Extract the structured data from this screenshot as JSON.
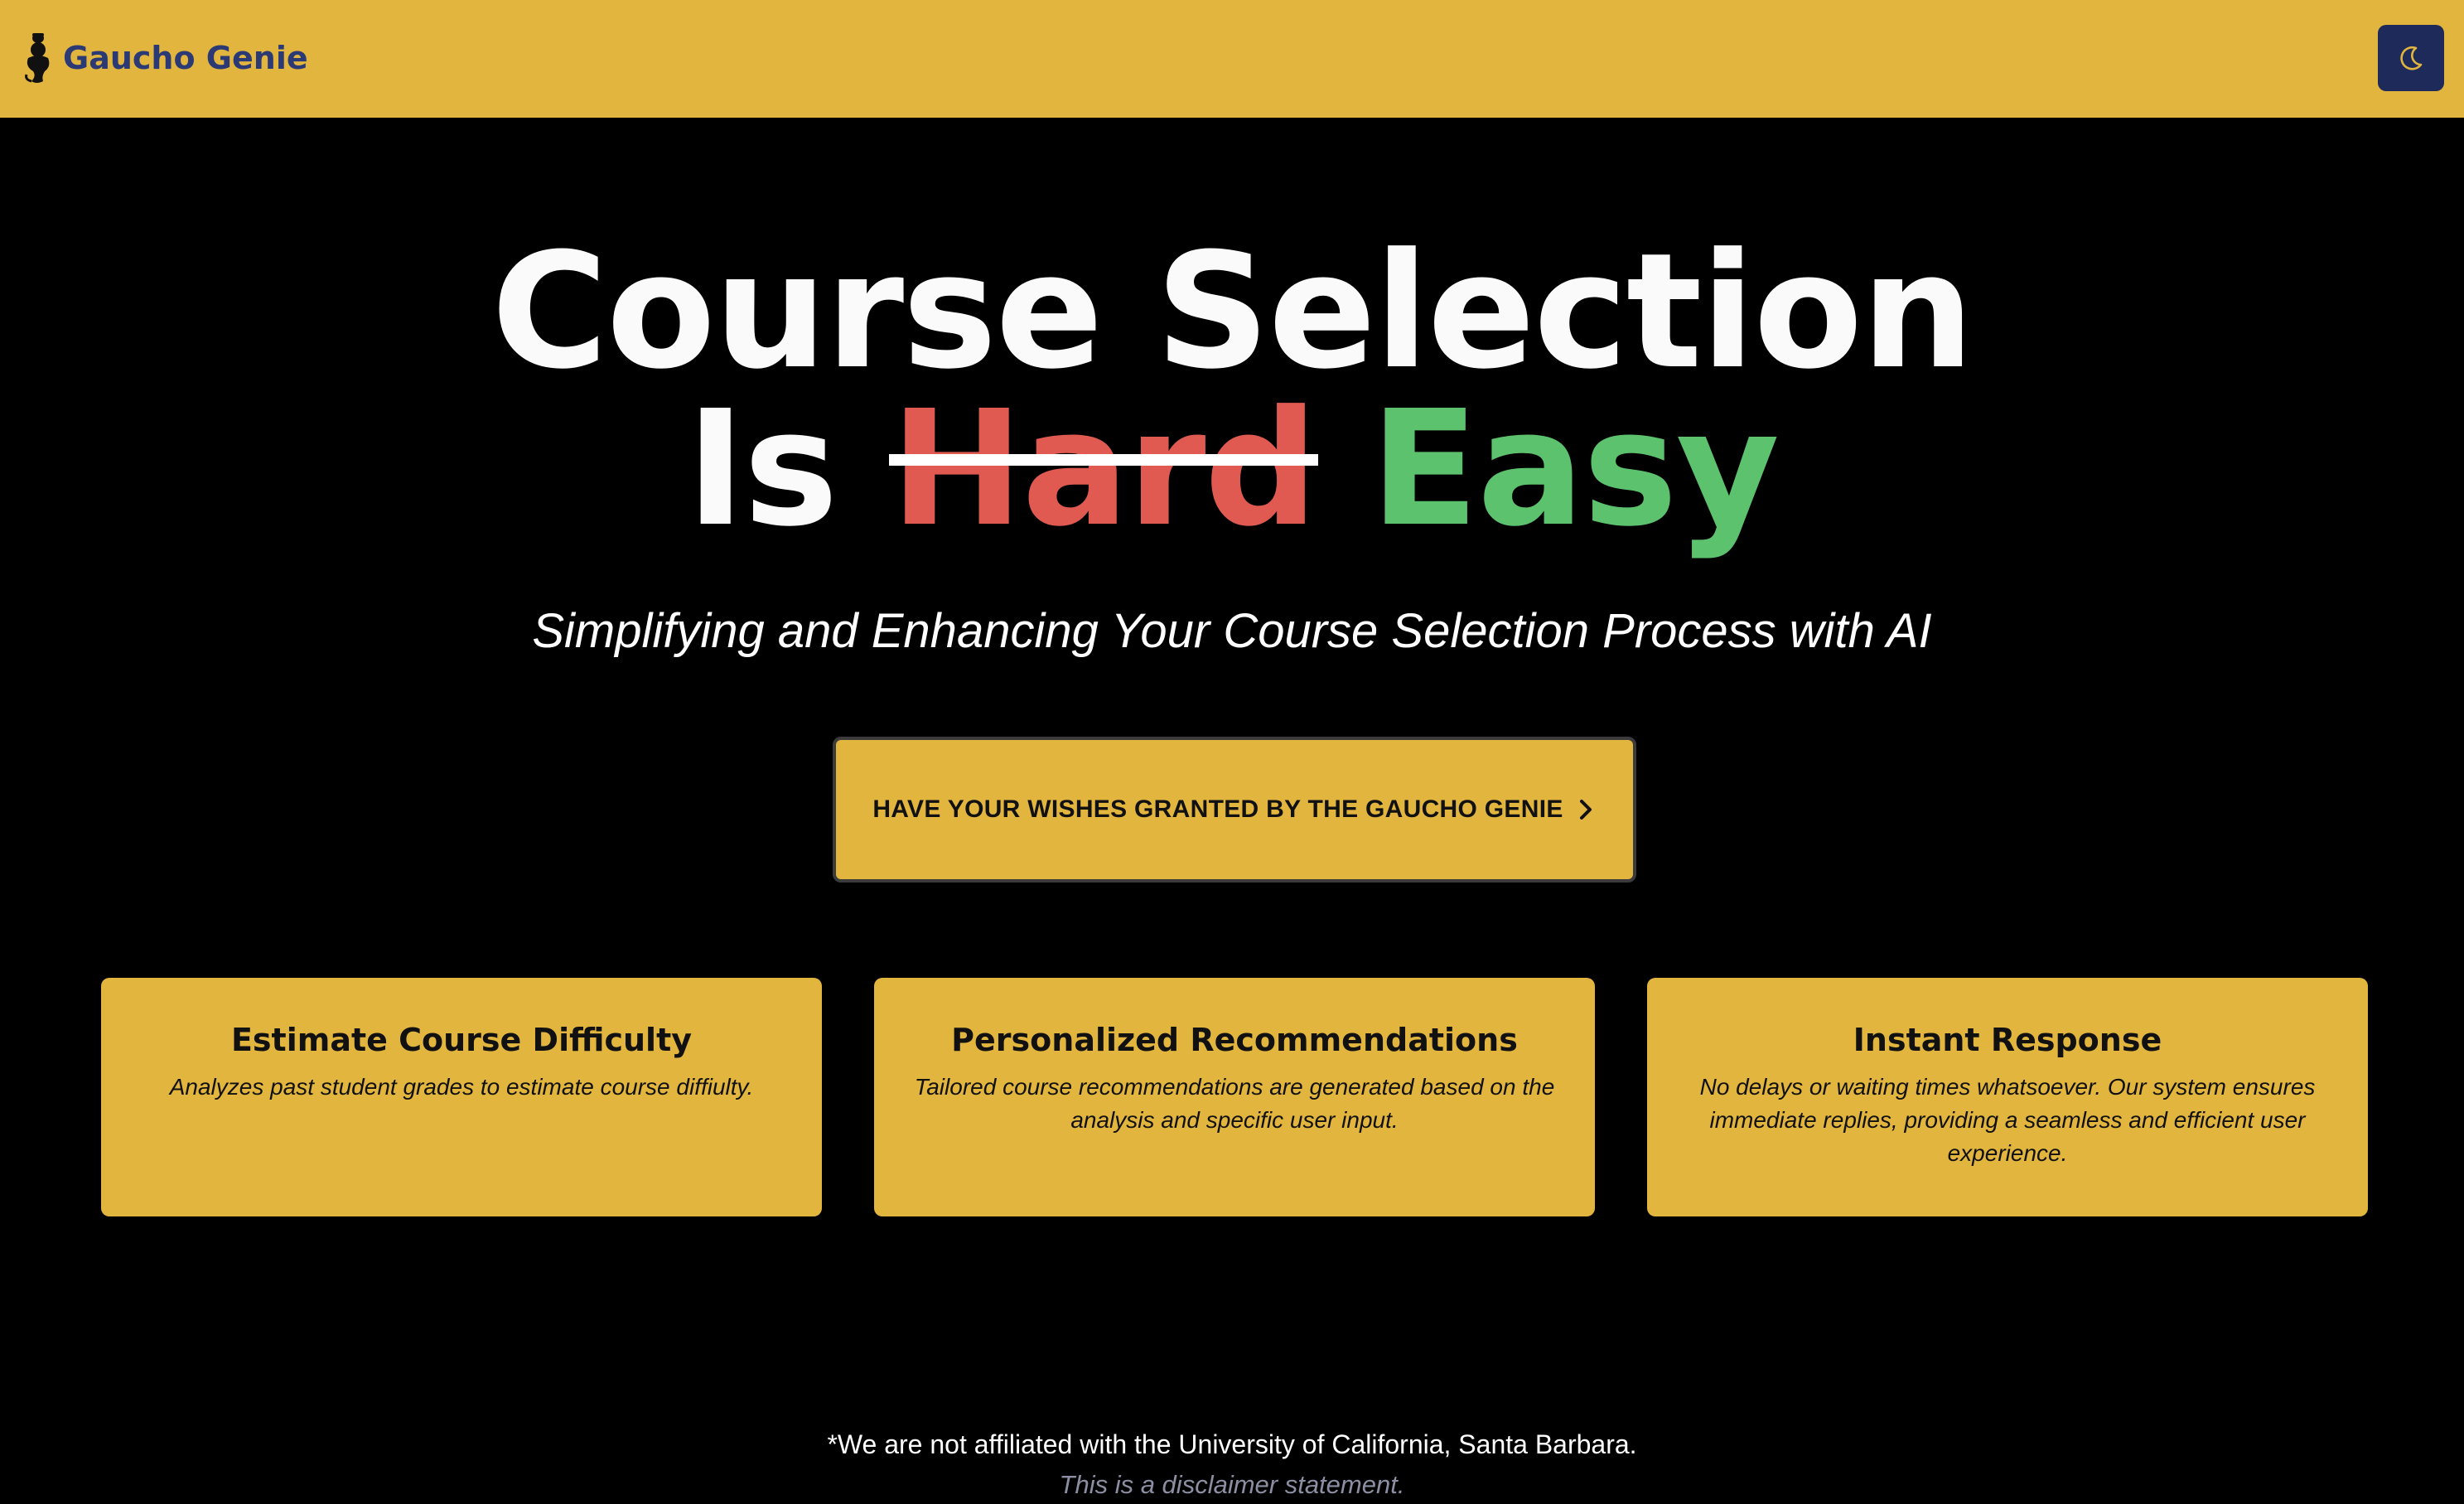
{
  "navbar": {
    "brand_name": "Gaucho Genie",
    "logo_icon": "genie-icon",
    "theme_toggle_icon": "moon-icon"
  },
  "hero": {
    "line1": "Course Selection",
    "line2_prefix": "Is",
    "struck_word": "Hard",
    "replacement_word": "Easy",
    "subtitle": "Simplifying and Enhancing Your Course Selection Process with AI"
  },
  "cta": {
    "label": "HAVE YOUR WISHES GRANTED BY THE GAUCHO GENIE",
    "icon": "chevron-right-icon"
  },
  "features": [
    {
      "title": "Estimate Course Difficulty",
      "description": "Analyzes past student grades to estimate course diffiulty."
    },
    {
      "title": "Personalized Recommendations",
      "description": "Tailored course recommendations are generated based on the analysis and specific user input."
    },
    {
      "title": "Instant Response",
      "description": "No delays or waiting times whatsoever. Our system ensures immediate replies, providing a seamless and efficient user experience."
    }
  ],
  "footer": {
    "disclaimer": "*We are not affiliated with the University of California, Santa Barbara.",
    "disclaimer_note": "This is a disclaimer statement."
  },
  "colors": {
    "accent_gold": "#E2B53E",
    "brand_navy": "#2B3A75",
    "hard_red": "#E05A52",
    "easy_green": "#5DC26E",
    "background": "#000000"
  }
}
